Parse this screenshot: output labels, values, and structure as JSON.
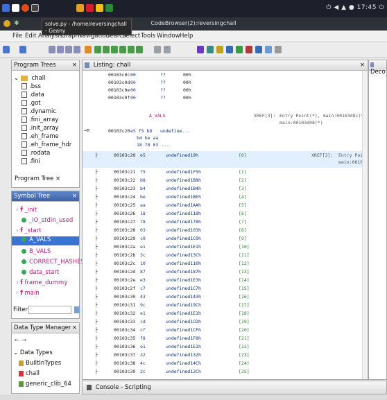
{
  "taskbar": {
    "tray_text": "⏻ ◀ ▲ ● 17:45 ⏻"
  },
  "window": {
    "title": "CodeBrowser(2):reversingchall",
    "tooltip_line1": "solve.py - /home/reversingchall - Geany"
  },
  "menubar": {
    "items": [
      "File",
      "Edit",
      "Analysis",
      "Graph",
      "Navigation",
      "Search",
      "Select",
      "Tools",
      "Window",
      "Help"
    ]
  },
  "program_trees": {
    "header": "Program Trees",
    "root": "chall",
    "sections": [
      ".bss",
      ".data",
      ".got",
      ".dynamic",
      ".fini_array",
      ".init_array",
      ".eh_frame",
      ".eh_frame_hdr",
      ".rodata",
      ".fini"
    ],
    "tab_label": "Program Tree ×"
  },
  "symbol_tree": {
    "header": "Symbol Tree",
    "items": [
      "_init",
      "_IO_stdin_used",
      "_start",
      "A_VALS",
      "B_VALS",
      "CORRECT_HASHES",
      "data_start",
      "frame_dummy",
      "main"
    ],
    "selected_index": 3,
    "filter_label": "Filter:"
  },
  "data_type_manager": {
    "header": "Data Type Manager",
    "root": "Data Types",
    "items": [
      "BuiltInTypes",
      "chall",
      "generic_clib_64"
    ]
  },
  "listing": {
    "header": "Listing: chall",
    "top_rows": [
      {
        "addr": "00103c0c",
        "byte": "00",
        "mnem": "??",
        "oper": "00h"
      },
      {
        "addr": "00103c0d",
        "byte": "00",
        "mnem": "??",
        "oper": "00h"
      },
      {
        "addr": "00103c0e",
        "byte": "00",
        "mnem": "??",
        "oper": "00h"
      },
      {
        "addr": "00103c0f",
        "byte": "00",
        "mnem": "??",
        "oper": "00h"
      }
    ],
    "label": "A_VALS",
    "xref_label": "XREF[3]:",
    "xref_entries": "Entry Point(*), main:00103d8c(*),",
    "xref_entries2": "main:00103d98(*)",
    "undef_addr": "00103c20",
    "undef_bytes": "e5 f5 b8",
    "undef_bytes2": "b4 be aa",
    "undef_bytes3": "18 78 03 ...",
    "undef_mnem": "undefine...",
    "sub_header": {
      "addr": "00103c20",
      "byte": "e5",
      "mnem": "undefined19h",
      "oper": "[0]",
      "xref": "XREF[3]:",
      "xref_text": "Entry Poin",
      "xref_text2": "main:00103..."
    },
    "rows": [
      {
        "addr": "00103c21",
        "byte": "f5",
        "mnem": "undefined1F5h",
        "idx": "[1]"
      },
      {
        "addr": "00103c22",
        "byte": "b8",
        "mnem": "undefined1B8h",
        "idx": "[2]"
      },
      {
        "addr": "00103c23",
        "byte": "b4",
        "mnem": "undefined1B4h",
        "idx": "[3]"
      },
      {
        "addr": "00103c24",
        "byte": "be",
        "mnem": "undefined1BEh",
        "idx": "[4]"
      },
      {
        "addr": "00103c25",
        "byte": "aa",
        "mnem": "undefined1AAh",
        "idx": "[5]"
      },
      {
        "addr": "00103c26",
        "byte": "18",
        "mnem": "undefined118h",
        "idx": "[6]"
      },
      {
        "addr": "00103c27",
        "byte": "78",
        "mnem": "undefined178h",
        "idx": "[7]"
      },
      {
        "addr": "00103c28",
        "byte": "03",
        "mnem": "undefined103h",
        "idx": "[8]"
      },
      {
        "addr": "00103c29",
        "byte": "c0",
        "mnem": "undefined1C0h",
        "idx": "[9]"
      },
      {
        "addr": "00103c2a",
        "byte": "e1",
        "mnem": "undefined1E1h",
        "idx": "[10]"
      },
      {
        "addr": "00103c2b",
        "byte": "3c",
        "mnem": "undefined13Ch",
        "idx": "[11]"
      },
      {
        "addr": "00103c2c",
        "byte": "10",
        "mnem": "undefined110h",
        "idx": "[12]"
      },
      {
        "addr": "00103c2d",
        "byte": "87",
        "mnem": "undefined187h",
        "idx": "[13]"
      },
      {
        "addr": "00103c2e",
        "byte": "e3",
        "mnem": "undefined1E3h",
        "idx": "[14]"
      },
      {
        "addr": "00103c2f",
        "byte": "c7",
        "mnem": "undefined1C7h",
        "idx": "[15]"
      },
      {
        "addr": "00103c30",
        "byte": "43",
        "mnem": "undefined143h",
        "idx": "[16]"
      },
      {
        "addr": "00103c31",
        "byte": "9c",
        "mnem": "undefined19Ch",
        "idx": "[17]"
      },
      {
        "addr": "00103c32",
        "byte": "e1",
        "mnem": "undefined1E1h",
        "idx": "[18]"
      },
      {
        "addr": "00103c33",
        "byte": "cd",
        "mnem": "undefined1CDh",
        "idx": "[19]"
      },
      {
        "addr": "00103c34",
        "byte": "cf",
        "mnem": "undefined1CFh",
        "idx": "[20]"
      },
      {
        "addr": "00103c35",
        "byte": "f8",
        "mnem": "undefined1F8h",
        "idx": "[21]"
      },
      {
        "addr": "00103c36",
        "byte": "e1",
        "mnem": "undefined1E1h",
        "idx": "[22]"
      },
      {
        "addr": "00103c37",
        "byte": "32",
        "mnem": "undefined132h",
        "idx": "[23]"
      },
      {
        "addr": "00103c38",
        "byte": "4c",
        "mnem": "undefined14Ch",
        "idx": "[24]"
      },
      {
        "addr": "00103c39",
        "byte": "2c",
        "mnem": "undefined12Ch",
        "idx": "[25]"
      }
    ]
  },
  "decompiler": {
    "header": "Deco"
  },
  "console": {
    "label": "Console - Scripting"
  }
}
